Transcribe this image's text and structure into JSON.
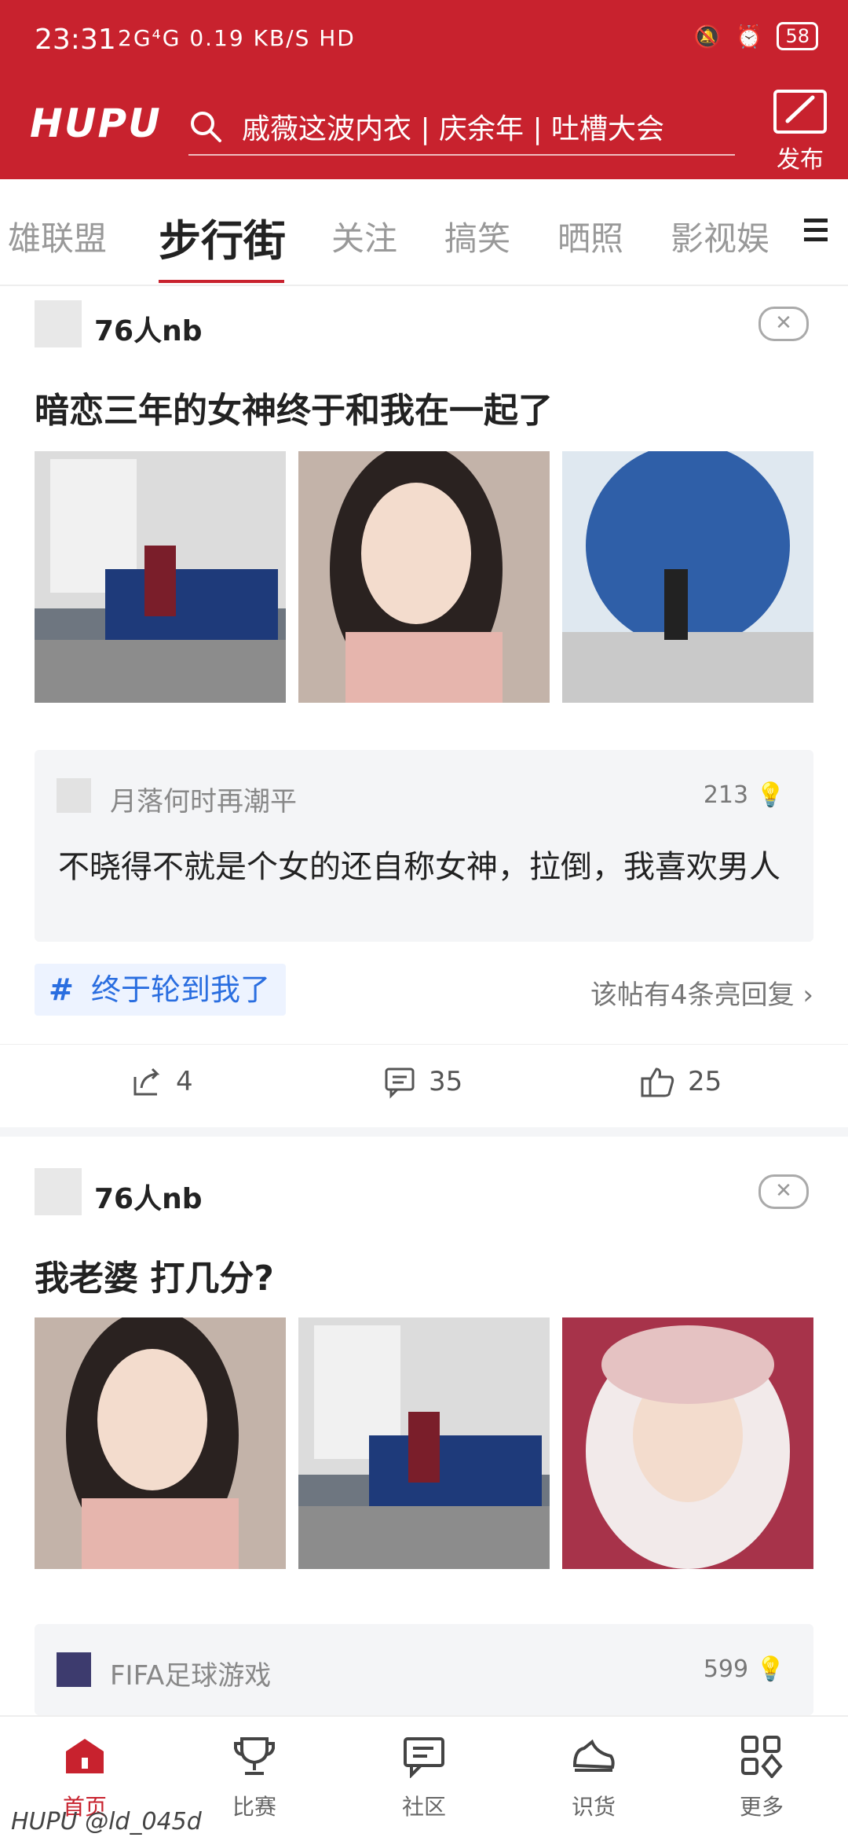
{
  "status_bar": {
    "time": "23:31",
    "network": "2G⁴G 0.19 KB/S HD",
    "battery": "58"
  },
  "header": {
    "logo": "HUPU",
    "search_placeholder": "戚薇这波内衣 | 庆余年 | 吐槽大会",
    "publish_label": "发布"
  },
  "tabs": [
    {
      "label": "雄联盟"
    },
    {
      "label": "步行街"
    },
    {
      "label": "关注"
    },
    {
      "label": "搞笑"
    },
    {
      "label": "晒照"
    },
    {
      "label": "影视娱"
    }
  ],
  "posts": [
    {
      "author": "76人nb",
      "title": "暗恋三年的女神终于和我在一起了",
      "comment": {
        "user": "月落何时再潮平",
        "likes": "213",
        "text": "不晓得不就是个女的还自称女神，拉倒，我喜欢男人"
      },
      "topic": "终于轮到我了",
      "replies": "该帖有4条亮回复",
      "shares": "4",
      "comments": "35",
      "upvotes": "25"
    },
    {
      "author": "76人nb",
      "title": "我老婆 打几分?",
      "comment": {
        "user": "FIFA足球游戏",
        "likes": "599"
      }
    }
  ],
  "bottom_nav": [
    {
      "label": "首页"
    },
    {
      "label": "比赛"
    },
    {
      "label": "社区"
    },
    {
      "label": "识货"
    },
    {
      "label": "更多"
    }
  ],
  "watermark": "HUPU @ld_045d",
  "colors": {
    "brand": "#c8222e",
    "topic_blue": "#2a6ee0",
    "background_gray": "#f4f5f7"
  }
}
